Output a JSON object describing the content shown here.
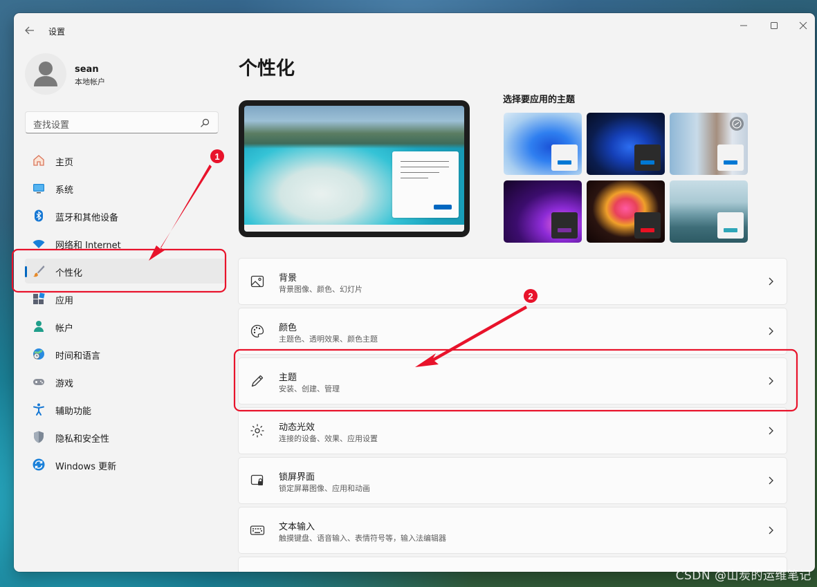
{
  "window": {
    "app_title": "设置"
  },
  "profile": {
    "name": "sean",
    "account_type": "本地帐户"
  },
  "search": {
    "placeholder": "查找设置"
  },
  "nav": {
    "items": [
      {
        "label": "主页",
        "icon": "home-icon"
      },
      {
        "label": "系统",
        "icon": "system-icon"
      },
      {
        "label": "蓝牙和其他设备",
        "icon": "bluetooth-icon"
      },
      {
        "label": "网络和 Internet",
        "icon": "wifi-icon"
      },
      {
        "label": "个性化",
        "icon": "brush-icon",
        "selected": true
      },
      {
        "label": "应用",
        "icon": "apps-icon"
      },
      {
        "label": "帐户",
        "icon": "account-icon"
      },
      {
        "label": "时间和语言",
        "icon": "globe-clock-icon"
      },
      {
        "label": "游戏",
        "icon": "gamepad-icon"
      },
      {
        "label": "辅助功能",
        "icon": "accessibility-icon"
      },
      {
        "label": "隐私和安全性",
        "icon": "shield-icon"
      },
      {
        "label": "Windows 更新",
        "icon": "update-icon"
      }
    ]
  },
  "main": {
    "title": "个性化",
    "themes_heading": "选择要应用的主题",
    "themes": [
      {
        "name": "light-bloom",
        "accent": "#0078d4"
      },
      {
        "name": "dark-bloom",
        "accent": "#0078d4"
      },
      {
        "name": "flowers",
        "accent": "#0078d4"
      },
      {
        "name": "glow",
        "accent": "#7a2fa0"
      },
      {
        "name": "captured-motion",
        "accent": "#e81123"
      },
      {
        "name": "sunrise",
        "accent": "#2fa6b8"
      }
    ],
    "settings": [
      {
        "title": "背景",
        "subtitle": "背景图像、颜色、幻灯片",
        "icon": "image-icon"
      },
      {
        "title": "颜色",
        "subtitle": "主题色、透明效果、颜色主题",
        "icon": "palette-icon"
      },
      {
        "title": "主题",
        "subtitle": "安装、创建、管理",
        "icon": "pen-icon"
      },
      {
        "title": "动态光效",
        "subtitle": "连接的设备、效果、应用设置",
        "icon": "dynamic-lighting-icon"
      },
      {
        "title": "锁屏界面",
        "subtitle": "锁定屏幕图像、应用和动画",
        "icon": "lock-screen-icon"
      },
      {
        "title": "文本输入",
        "subtitle": "触摸键盘、语音输入、表情符号等，输入法编辑器",
        "icon": "keyboard-icon"
      }
    ]
  },
  "annotations": {
    "marker_1": "1",
    "marker_2": "2",
    "color": "#e8132b"
  },
  "watermark": "CSDN @山炭的运维笔记",
  "colors": {
    "accent": "#0067c0",
    "window_bg": "#f3f3f3"
  }
}
